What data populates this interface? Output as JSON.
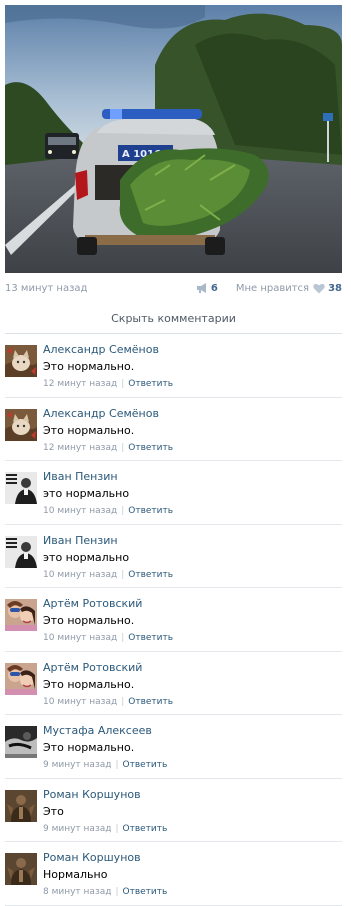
{
  "post": {
    "time": "13 минут назад",
    "shares": "6",
    "like_label": "Мне нравится",
    "likes": "38",
    "plate_text": "А 1016"
  },
  "hide_comments_label": "Скрыть комментарии",
  "reply_label": "Ответить",
  "colors": {
    "link": "#2b587a",
    "muted": "#8f9aa8",
    "divider": "#dae1e8"
  },
  "comments": [
    {
      "author": "Александр Семёнов",
      "text": "Это нормально.",
      "time": "12 минут назад",
      "avatar": "cat"
    },
    {
      "author": "Александр Семёнов",
      "text": "Это нормально.",
      "time": "12 минут назад",
      "avatar": "cat"
    },
    {
      "author": "Иван Пензин",
      "text": "это нормально",
      "time": "10 минут назад",
      "avatar": "man-bw"
    },
    {
      "author": "Иван Пензин",
      "text": "это нормально",
      "time": "10 минут назад",
      "avatar": "man-bw"
    },
    {
      "author": "Артём Ротовский",
      "text": "Это нормально.",
      "time": "10 минут назад",
      "avatar": "girls"
    },
    {
      "author": "Артём Ротовский",
      "text": "Это нормально.",
      "time": "10 минут назад",
      "avatar": "girls"
    },
    {
      "author": "Мустафа Алексеев",
      "text": "Это нормально.",
      "time": "9 минут назад",
      "avatar": "dark-bw"
    },
    {
      "author": "Роман Коршунов",
      "text": "Это",
      "time": "9 минут назад",
      "avatar": "figure"
    },
    {
      "author": "Роман Коршунов",
      "text": "Нормально",
      "time": "8 минут назад",
      "avatar": "figure"
    }
  ]
}
